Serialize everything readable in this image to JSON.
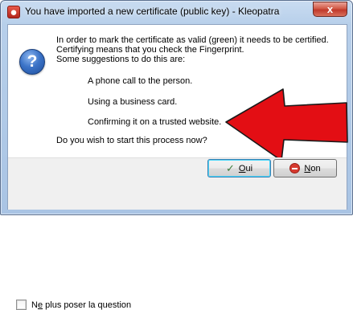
{
  "window": {
    "title": "You have imported a new certificate (public key) - Kleopatra",
    "close_glyph": "x"
  },
  "icons": {
    "app": "kleopatra-app-icon",
    "question": "question-icon",
    "question_glyph": "?",
    "arrow": "red-arrow-annotation",
    "arrow_color": "#e30e14"
  },
  "message": {
    "line1": "In order to mark the certificate as valid (green) it needs to be certified.",
    "line2": "Certifying means that you check the Fingerprint.",
    "line3": "Some suggestions to do this are:",
    "suggestions": [
      "A phone call to the person.",
      "Using a business card.",
      "Confirming it on a trusted website."
    ],
    "prompt": "Do you wish to start this process now?"
  },
  "checkbox": {
    "label_prefix": "N",
    "label_mnemonic": "e",
    "label_rest": " plus poser la question",
    "checked": false
  },
  "buttons": {
    "yes_glyph": "✓",
    "yes_mnemonic": "O",
    "yes_rest": "ui",
    "no_mnemonic": "N",
    "no_rest": "on"
  }
}
